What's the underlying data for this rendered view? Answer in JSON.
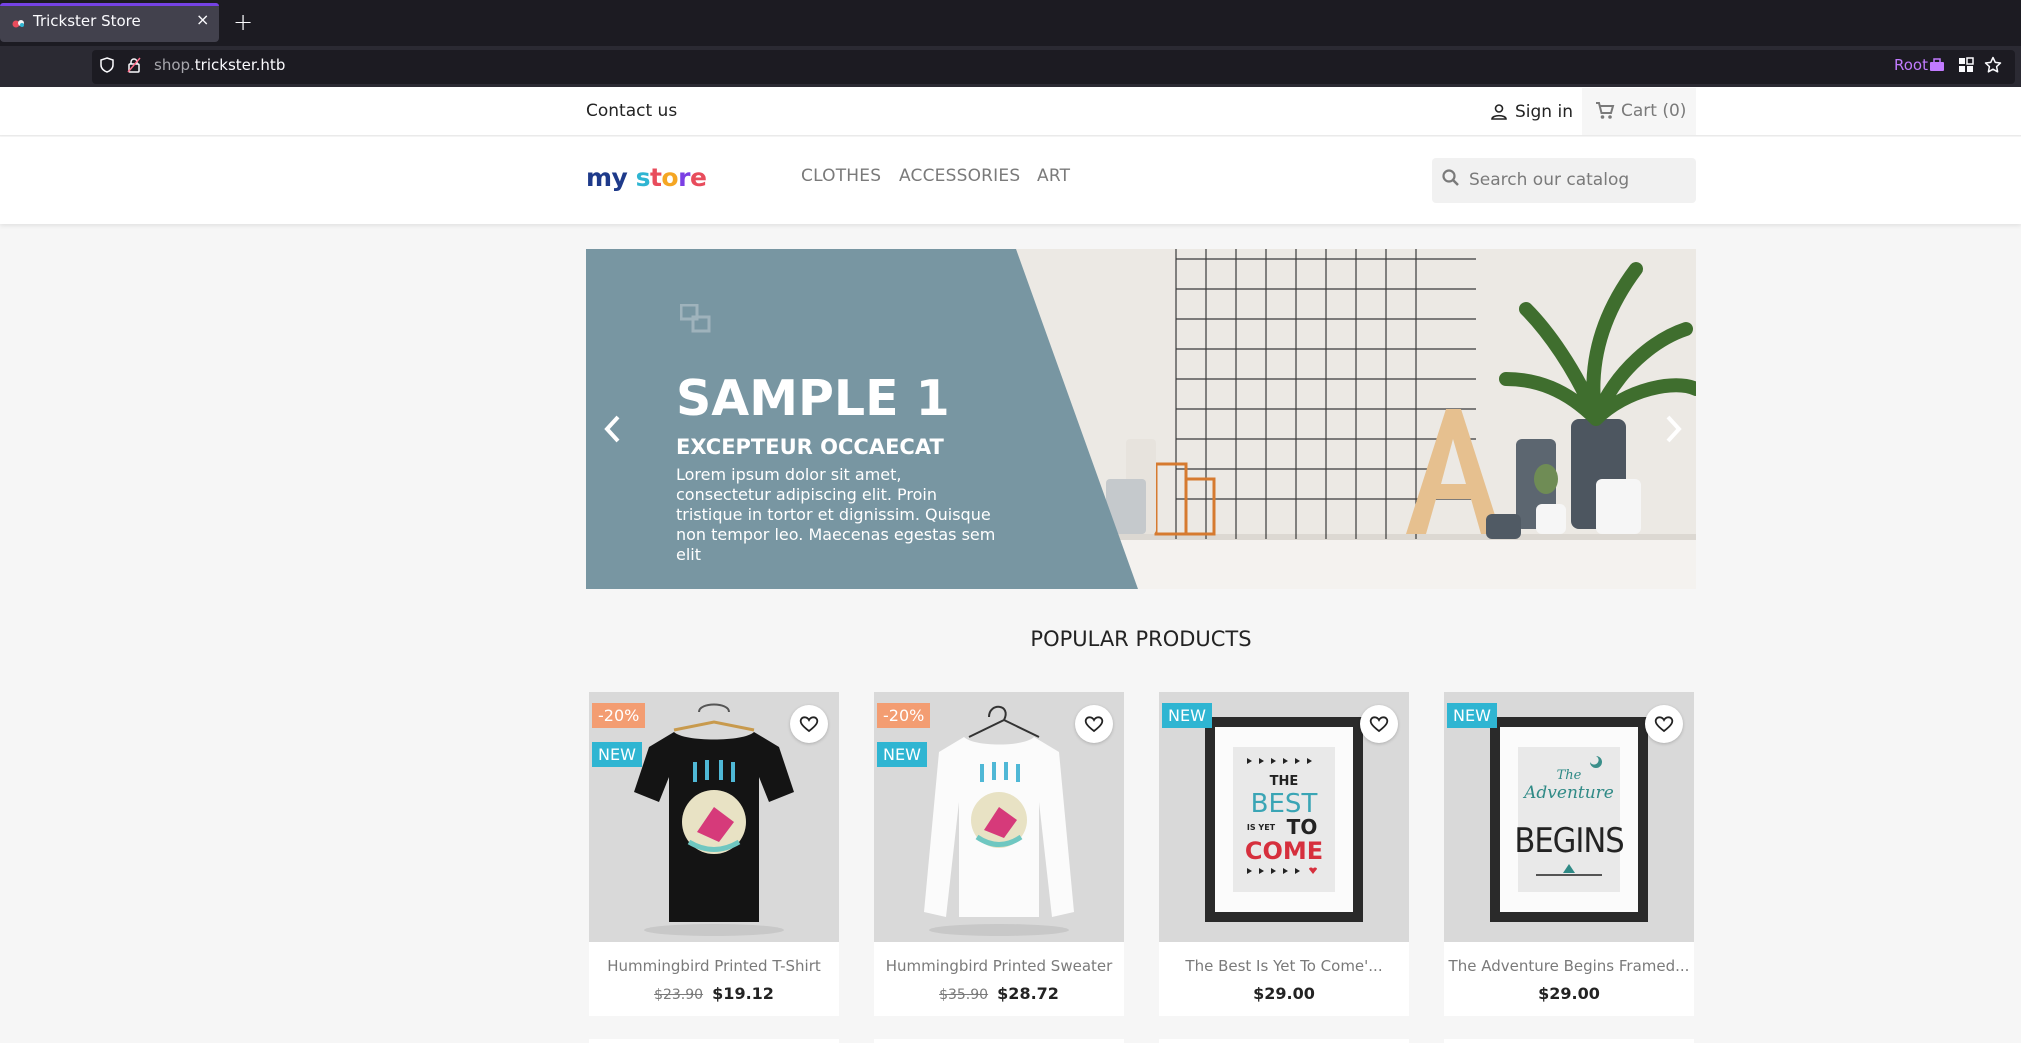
{
  "browser": {
    "tab_title": "Trickster Store",
    "tab_close": "×",
    "new_tab": "+",
    "url_prefix": "shop.",
    "url_domain": "trickster.htb",
    "root_label": "Root"
  },
  "header": {
    "contact": "Contact us",
    "signin": "Sign in",
    "cart": "Cart (0)",
    "logo": {
      "w1": "my",
      "s": "s",
      "t": "t",
      "o": "o",
      "r": "r",
      "e": "e"
    },
    "menu": [
      "CLOTHES",
      "ACCESSORIES",
      "ART"
    ],
    "search_placeholder": "Search our catalog"
  },
  "hero": {
    "title": "SAMPLE 1",
    "subtitle": "EXCEPTEUR OCCAECAT",
    "text": "Lorem ipsum dolor sit amet, consectetur adipiscing elit. Proin tristique in tortor et dignissim. Quisque non tempor leo. Maecenas egestas sem elit"
  },
  "products_section": {
    "title": "POPULAR PRODUCTS",
    "items": [
      {
        "name": "Hummingbird Printed T-Shirt",
        "old_price": "$23.90",
        "price": "$19.12",
        "discount": "-20%",
        "new": "NEW"
      },
      {
        "name": "Hummingbird Printed Sweater",
        "old_price": "$35.90",
        "price": "$28.72",
        "discount": "-20%",
        "new": "NEW"
      },
      {
        "name": "The Best Is Yet To Come'...",
        "old_price": "",
        "price": "$29.00",
        "discount": "",
        "new": "NEW"
      },
      {
        "name": "The Adventure Begins Framed...",
        "old_price": "",
        "price": "$29.00",
        "discount": "",
        "new": "NEW"
      }
    ]
  },
  "art": {
    "poster1": [
      "THE",
      "BEST",
      "IS YET",
      "TO",
      "COME"
    ],
    "poster2": [
      "The",
      "Adventure",
      "BEGINS"
    ]
  },
  "colors": {
    "accent": "#2fb5d2",
    "discount": "#f39d72",
    "hero_panel": "#7896a2"
  }
}
